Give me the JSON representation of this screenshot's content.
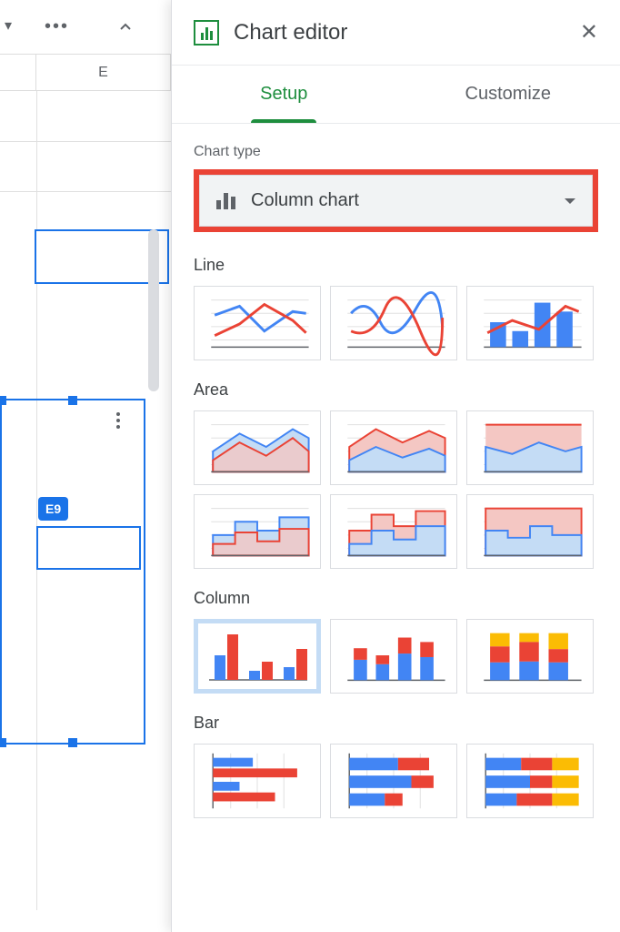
{
  "panel": {
    "title": "Chart editor",
    "close": "✕"
  },
  "tabs": [
    {
      "label": "Setup",
      "active": true
    },
    {
      "label": "Customize",
      "active": false
    }
  ],
  "chart_type": {
    "label": "Chart type",
    "value": "Column chart"
  },
  "sections": [
    {
      "label": "Line"
    },
    {
      "label": "Area"
    },
    {
      "label": "Column"
    },
    {
      "label": "Bar"
    }
  ],
  "sheet": {
    "column_header": "E",
    "cell_ref": "E9"
  }
}
